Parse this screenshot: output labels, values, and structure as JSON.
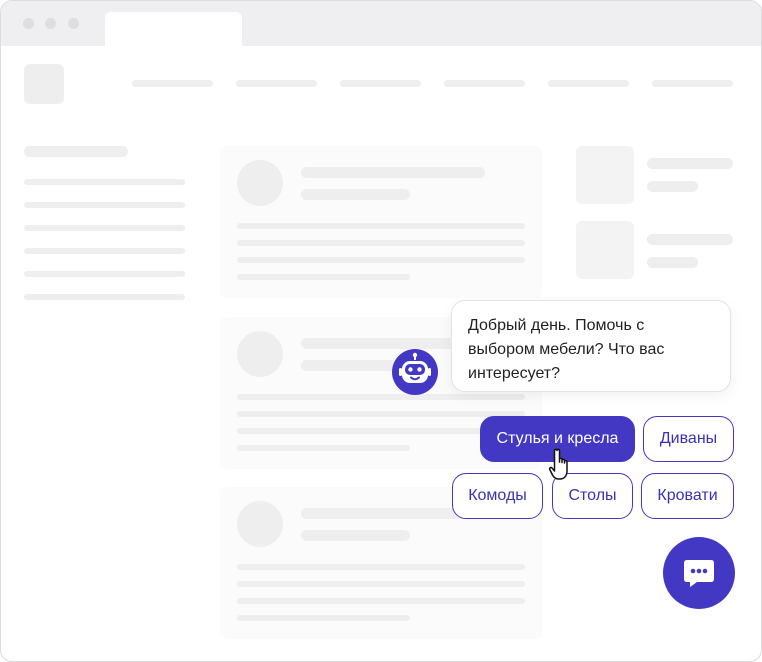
{
  "chat": {
    "bot_message": "Добрый день. Помочь с выбором мебели? Что вас интересует?",
    "options": [
      {
        "label": "Стулья и кресла",
        "selected": true
      },
      {
        "label": "Диваны",
        "selected": false
      },
      {
        "label": "Комоды",
        "selected": false
      },
      {
        "label": "Столы",
        "selected": false
      },
      {
        "label": "Кровати",
        "selected": false
      }
    ],
    "avatar_icon": "robot-icon",
    "launcher_icon": "chat-bubble-icon"
  },
  "theme": {
    "accent": "#4338c4",
    "skeleton": "#eeeeef",
    "titlebar": "#efeff1"
  }
}
